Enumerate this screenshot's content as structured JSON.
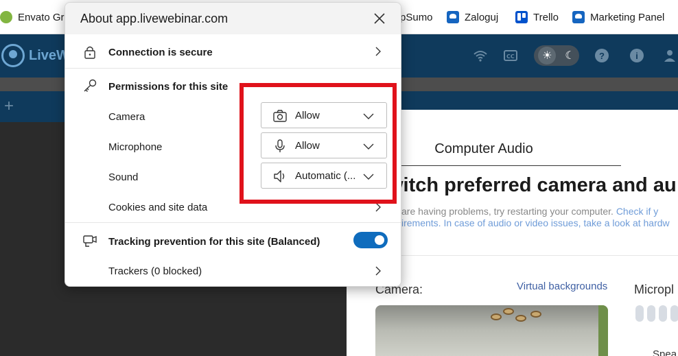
{
  "bookmarks": [
    {
      "label": "Envato Grap",
      "icon": "envato-icon"
    },
    {
      "label": "pSumo",
      "icon": "none"
    },
    {
      "label": "Zaloguj",
      "icon": "livewebinar-icon"
    },
    {
      "label": "Trello",
      "icon": "trello-icon"
    },
    {
      "label": "Marketing Panel",
      "icon": "livewebinar-icon"
    }
  ],
  "app": {
    "logo_text": "LiveW",
    "plus": "+"
  },
  "main": {
    "tab_title": "Computer Audio",
    "headline": "witch preferred camera and au",
    "help_line1_text": " are having problems, try restarting your computer. ",
    "help_line1_link": "Check if y",
    "help_line2_link": "irements. In case of audio or video issues, take a look at hardw",
    "camera_label": "Camera:",
    "virtual_backgrounds": "Virtual backgrounds",
    "mic_label": "Micropl",
    "speaker_label": "Spea"
  },
  "popup": {
    "title": "About app.livewebinar.com",
    "connection": "Connection is secure",
    "permissions_header": "Permissions for this site",
    "permissions": [
      {
        "label": "Camera",
        "value": "Allow",
        "icon": "camera-icon"
      },
      {
        "label": "Microphone",
        "value": "Allow",
        "icon": "microphone-icon"
      },
      {
        "label": "Sound",
        "value": "Automatic (...",
        "icon": "speaker-icon"
      }
    ],
    "cookies": "Cookies and site data",
    "tracking": "Tracking prevention for this site (Balanced)",
    "tracking_on": true,
    "trackers": "Trackers (0 blocked)"
  },
  "colors": {
    "header": "#0f3a5c",
    "highlight": "#e0121b",
    "toggle": "#0f6cbd"
  }
}
